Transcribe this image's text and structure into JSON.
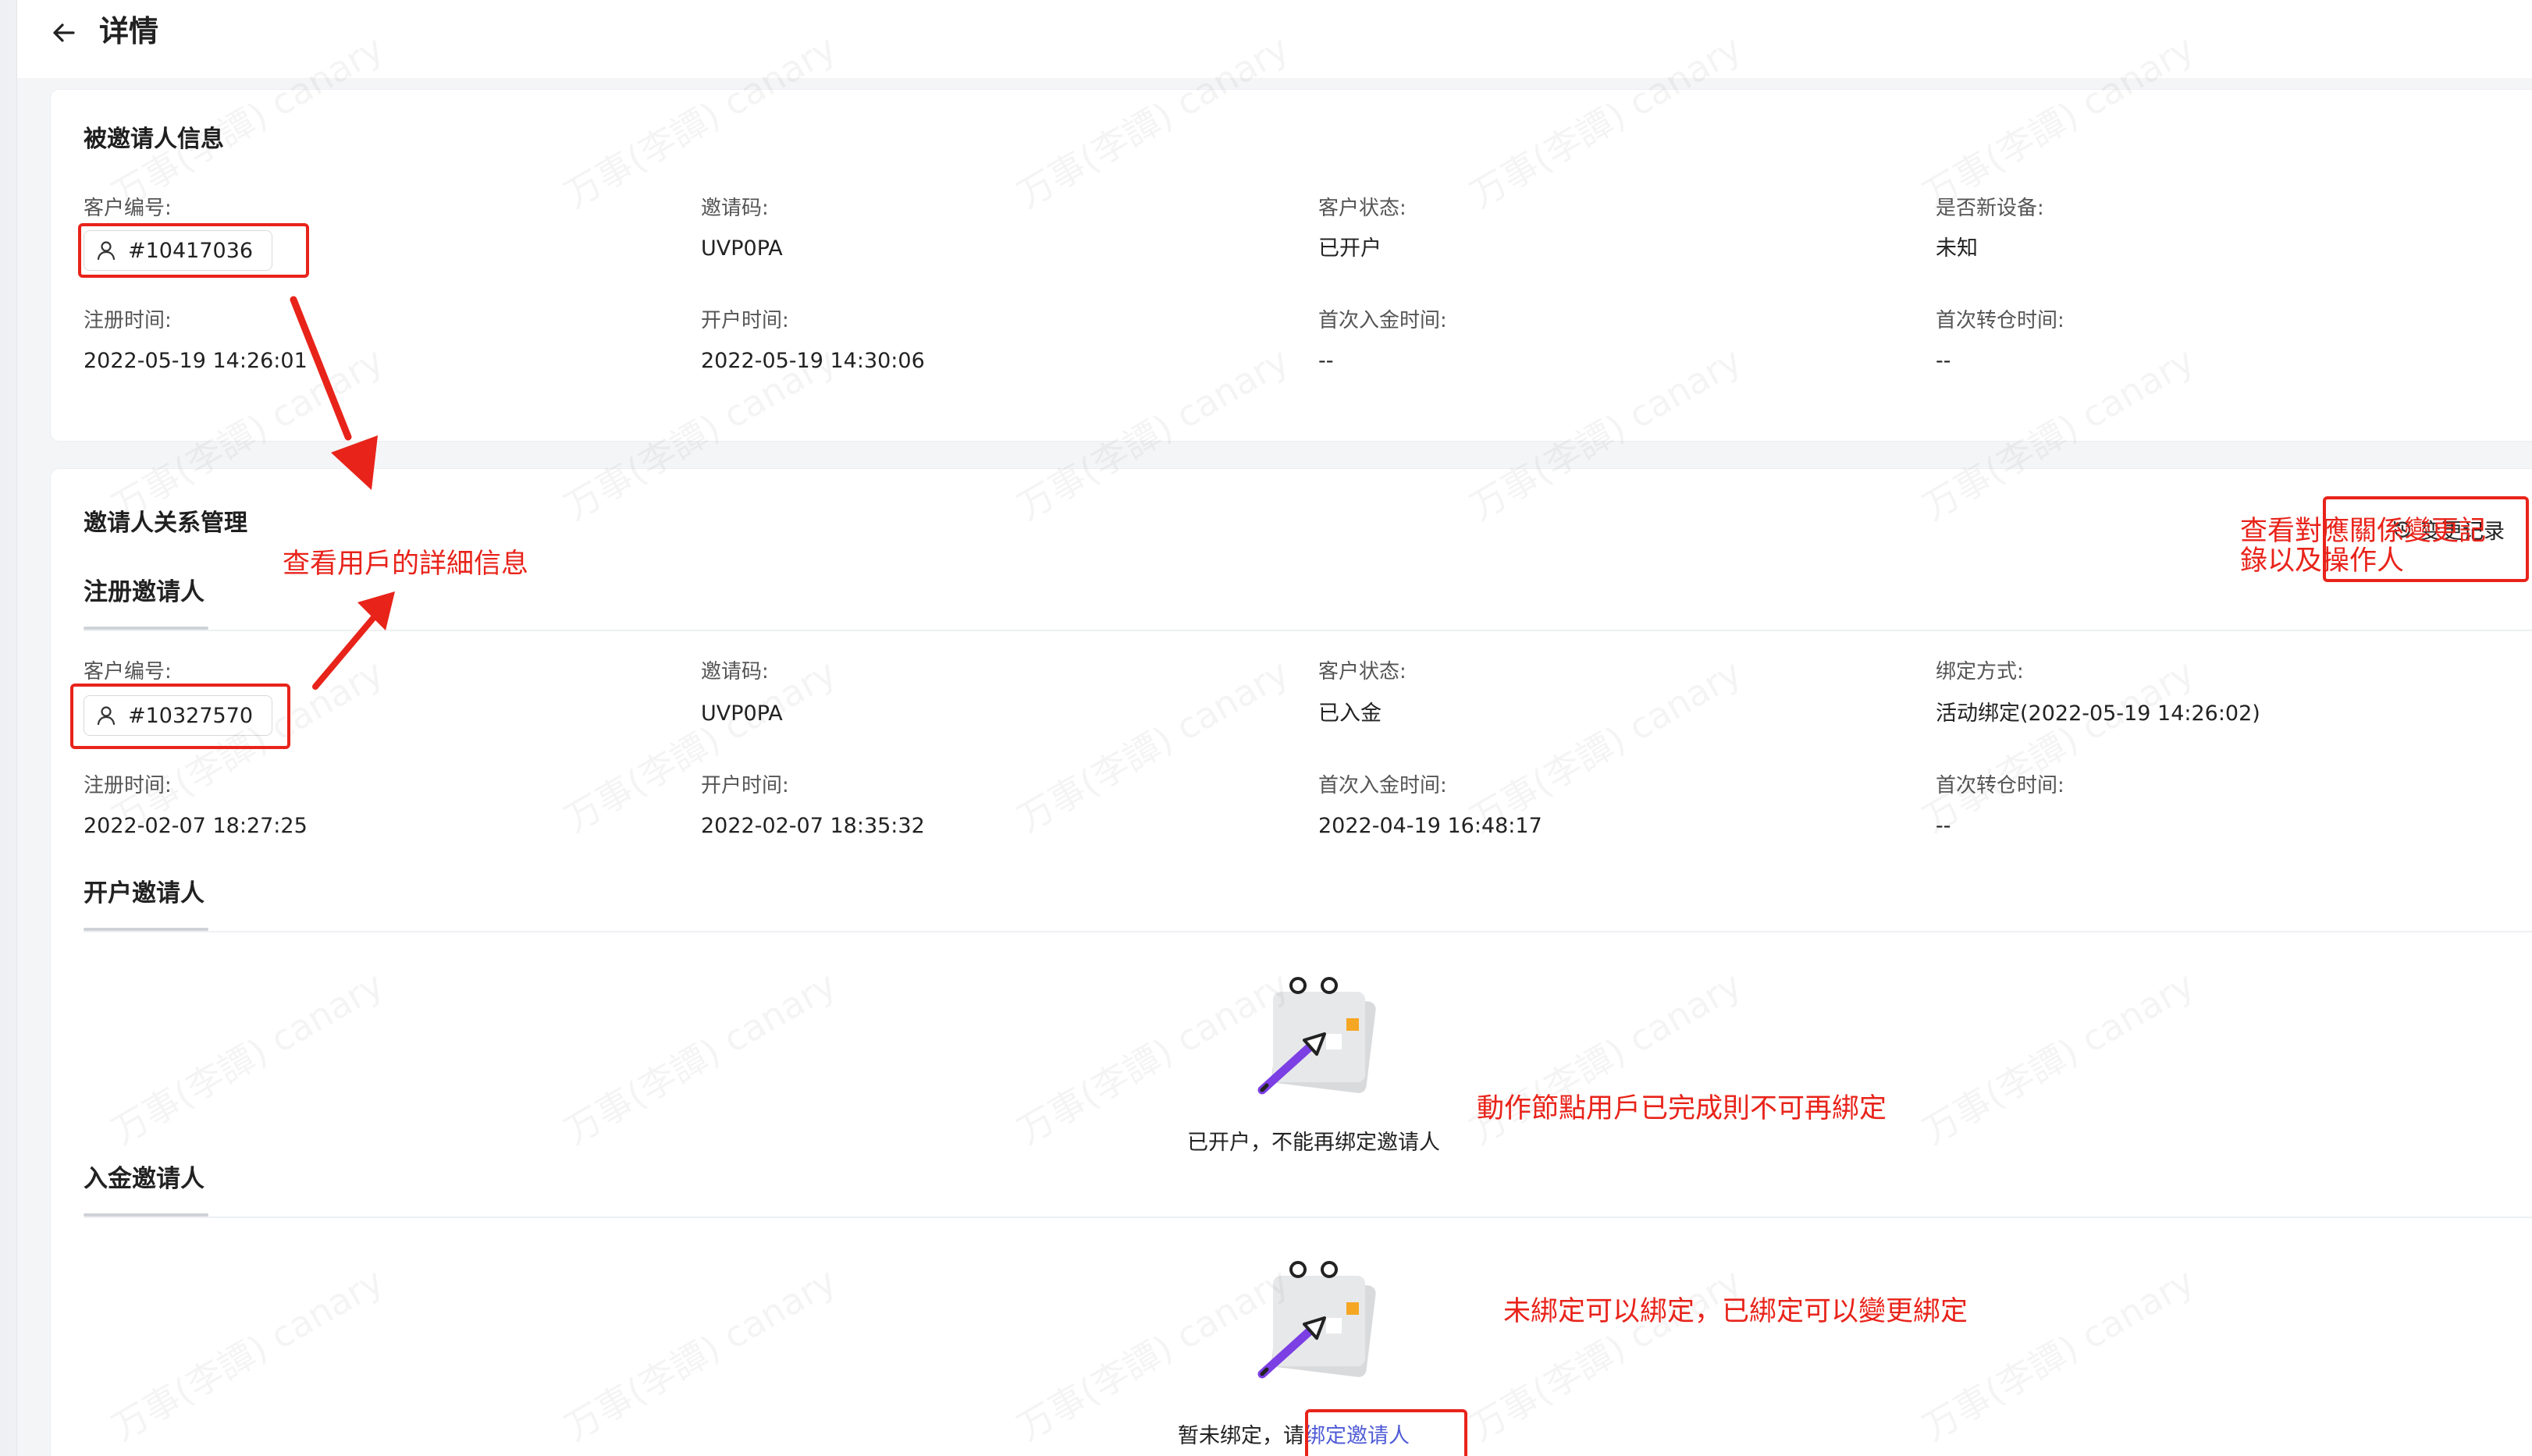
{
  "header": {
    "title": "详情"
  },
  "invitee_info": {
    "title": "被邀请人信息",
    "fields": {
      "customer_id_label": "客户编号:",
      "customer_id": "#10417036",
      "invite_code_label": "邀请码:",
      "invite_code": "UVP0PA",
      "status_label": "客户状态:",
      "status": "已开户",
      "new_device_label": "是否新设备:",
      "new_device": "未知",
      "reg_time_label": "注册时间:",
      "reg_time": "2022-05-19 14:26:01",
      "open_time_label": "开户时间:",
      "open_time": "2022-05-19 14:30:06",
      "first_deposit_label": "首次入金时间:",
      "first_deposit": "--",
      "first_transfer_label": "首次转仓时间:",
      "first_transfer": "--"
    }
  },
  "relation": {
    "title": "邀请人关系管理",
    "history_label": "变更记录",
    "reg_inviter": {
      "tab": "注册邀请人",
      "customer_id_label": "客户编号:",
      "customer_id": "#10327570",
      "invite_code_label": "邀请码:",
      "invite_code": "UVP0PA",
      "status_label": "客户状态:",
      "status": "已入金",
      "bind_method_label": "绑定方式:",
      "bind_method": "活动绑定(2022-05-19 14:26:02)",
      "reg_time_label": "注册时间:",
      "reg_time": "2022-02-07 18:27:25",
      "open_time_label": "开户时间:",
      "open_time": "2022-02-07 18:35:32",
      "first_deposit_label": "首次入金时间:",
      "first_deposit": "2022-04-19 16:48:17",
      "first_transfer_label": "首次转仓时间:",
      "first_transfer": "--"
    },
    "open_inviter": {
      "tab": "开户邀请人",
      "empty_text": "已开户，不能再绑定邀请人"
    },
    "deposit_inviter": {
      "tab": "入金邀请人",
      "empty_prefix": "暂未绑定，请",
      "bind_link": "绑定邀请人"
    }
  },
  "annotations": {
    "view_user_detail": "查看用戶的詳細信息",
    "view_history_line1": "查看對應關係變更記",
    "view_history_line2": "錄以及操作人",
    "cannot_bind": "動作節點用戶已完成則不可再綁定",
    "bind_note": "未綁定可以綁定，已綁定可以變更綁定"
  },
  "watermark": "万事(李譚) canary",
  "colors": {
    "annotation": "#e8231a",
    "link": "#4f5bd5",
    "accent": "#7b3fe4"
  }
}
